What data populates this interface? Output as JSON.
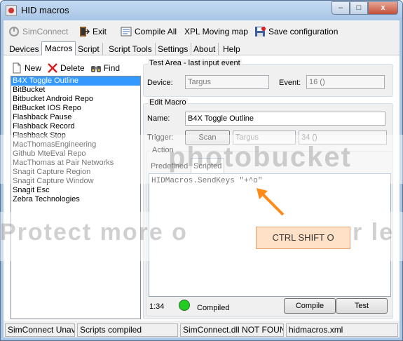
{
  "window": {
    "title": "HID macros",
    "min_glyph": "–",
    "max_glyph": "□",
    "close_glyph": "x"
  },
  "toolbar": {
    "simconnect": "SimConnect",
    "exit": "Exit",
    "compile_all": "Compile All",
    "xpl_map": "XPL Moving map",
    "save_config": "Save configuration"
  },
  "tabs": [
    "Devices",
    "Macros",
    "Script",
    "Script Tools",
    "Settings",
    "About",
    "Help"
  ],
  "active_tab": "Macros",
  "list_toolbar": {
    "new": "New",
    "delete": "Delete",
    "find": "Find"
  },
  "macros": [
    "B4X Toggle Outline",
    "BitBucket",
    "Bitbucket Android Repo",
    "BitBucket IOS Repo",
    "Flashback Pause",
    "Flashback Record",
    "Flashback Stop",
    "MacThomasEngineering",
    "Github MteEval Repo",
    "MacThomas at Pair Networks",
    "Snagit Capture Region",
    "Snagit Capture Window",
    "Snagit Esc",
    "Zebra Technologies"
  ],
  "selected_macro_index": 0,
  "test_area": {
    "legend": "Test Area - last input event",
    "device_label": "Device:",
    "device_value": "Targus",
    "event_label": "Event:",
    "event_value": "16 ()"
  },
  "edit_macro": {
    "legend": "Edit Macro",
    "name_label": "Name:",
    "name_value": "B4X Toggle Outline",
    "trigger_label": "Trigger:",
    "scan_button": "Scan",
    "trigger_device": "Targus",
    "trigger_event": "34 ()"
  },
  "action": {
    "legend": "Action",
    "tab_predefined": "Predefined",
    "tab_scripted": "Scripted",
    "code": "HIDMacros.SendKeys \"+^o\"",
    "cursor_pos": "1:34",
    "compile_status": "Compiled",
    "compile_status_color": "#22cc22",
    "compile_button": "Compile",
    "test_button": "Test"
  },
  "annotation": {
    "text": "CTRL SHIFT O",
    "arrow_color": "#ff8c1a"
  },
  "watermark": {
    "text": "photobucket",
    "left_text": "Protect more o",
    "right_text": "r le"
  },
  "statusbar": [
    "SimConnect Unav",
    "Scripts compiled",
    "SimConnect.dll NOT FOUN",
    "hidmacros.xml"
  ]
}
